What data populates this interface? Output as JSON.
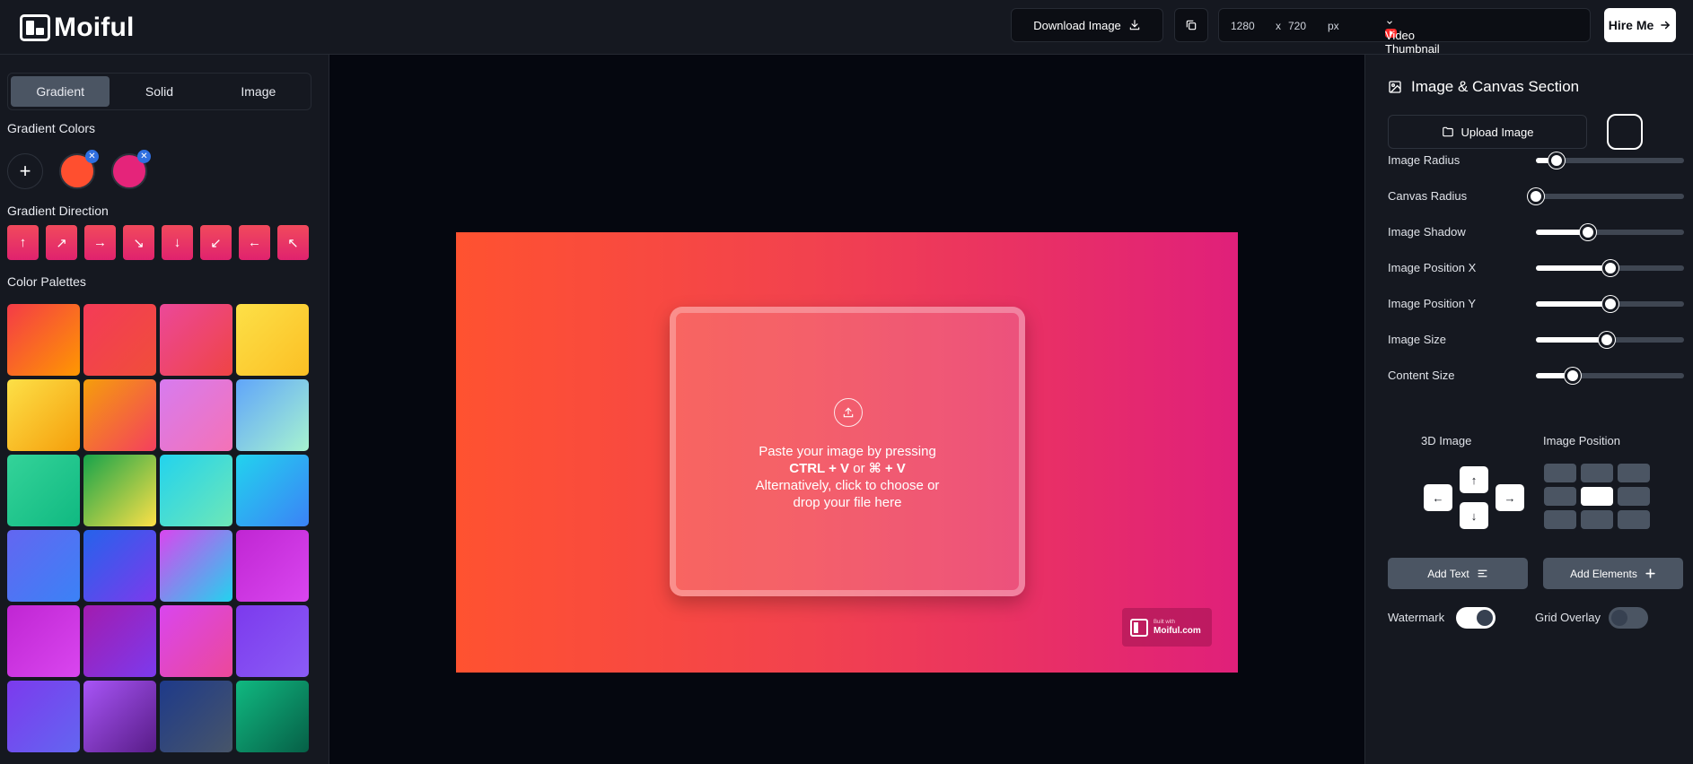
{
  "app": {
    "name": "Moiful"
  },
  "header": {
    "download_label": "Download Image",
    "width": "1280",
    "x_sep": "x",
    "height": "720",
    "unit": "px",
    "preset": "Video Thumbnail (1280 x 720)",
    "hire_label": "Hire Me"
  },
  "left": {
    "tabs": [
      "Gradient",
      "Solid",
      "Image"
    ],
    "active_tab": "Gradient",
    "gradient_colors_label": "Gradient Colors",
    "gradient_colors": [
      "#ff4f2f",
      "#e5247a"
    ],
    "direction_label": "Gradient Direction",
    "directions": [
      "up-arrow-icon",
      "up-right-arrow-icon",
      "right-arrow-icon",
      "down-right-arrow-icon",
      "down-arrow-icon",
      "down-left-arrow-icon",
      "left-arrow-icon",
      "up-left-arrow-icon"
    ],
    "palettes_label": "Color Palettes",
    "palettes": [
      [
        "#f43b47",
        "#ff9800"
      ],
      [
        "#f43b57",
        "#f04e3a"
      ],
      [
        "#ec4899",
        "#ef4444"
      ],
      [
        "#fde047",
        "#fbbf24"
      ],
      [
        "#fde047",
        "#f59e0b"
      ],
      [
        "#f59e0b",
        "#f43f5e"
      ],
      [
        "#d77bf0",
        "#f472b6"
      ],
      [
        "#60a5fa",
        "#a7f3d0"
      ],
      [
        "#34d399",
        "#10b981"
      ],
      [
        "#16a34a",
        "#fde047"
      ],
      [
        "#22d3ee",
        "#6ee7b7"
      ],
      [
        "#22d3ee",
        "#3b82f6"
      ],
      [
        "#6366f1",
        "#3b82f6"
      ],
      [
        "#2563eb",
        "#7c3aed"
      ],
      [
        "#d946ef",
        "#22d3ee"
      ],
      [
        "#c026d3",
        "#d946ef"
      ],
      [
        "#c026d3",
        "#d946ef"
      ],
      [
        "#a21caf",
        "#7c3aed"
      ],
      [
        "#d946ef",
        "#ec4899"
      ],
      [
        "#7c3aed",
        "#8b5cf6"
      ],
      [
        "#7c3aed",
        "#6366f1"
      ],
      [
        "#a855f7",
        "#581c87"
      ],
      [
        "#1e3a8a",
        "#475569"
      ],
      [
        "#10b981",
        "#065f46"
      ]
    ]
  },
  "canvas": {
    "dropzone_line1": "Paste your image by pressing",
    "shortcut_ctrl": "CTRL + V",
    "shortcut_or": "or",
    "shortcut_cmd": "⌘ + V",
    "dropzone_line3": "Alternatively, click to choose or",
    "dropzone_line4": "drop your file here",
    "watermark_small": "Built with",
    "watermark_big": "Moiful.com"
  },
  "right": {
    "title": "Image & Canvas Section",
    "upload_label": "Upload Image",
    "sliders": [
      {
        "label": "Image Radius",
        "value": 0.14
      },
      {
        "label": "Canvas Radius",
        "value": 0.0
      },
      {
        "label": "Image Shadow",
        "value": 0.35
      },
      {
        "label": "Image Position X",
        "value": 0.5
      },
      {
        "label": "Image Position Y",
        "value": 0.5
      },
      {
        "label": "Image Size",
        "value": 0.48
      },
      {
        "label": "Content Size",
        "value": 0.25
      }
    ],
    "three_d_label": "3D Image",
    "position_label": "Image Position",
    "arrows": {
      "up": "↑",
      "down": "↓",
      "left": "←",
      "right": "→"
    },
    "add_text_label": "Add Text",
    "add_elements_label": "Add Elements",
    "watermark_label": "Watermark",
    "watermark_on": true,
    "grid_label": "Grid Overlay",
    "grid_on": false
  }
}
